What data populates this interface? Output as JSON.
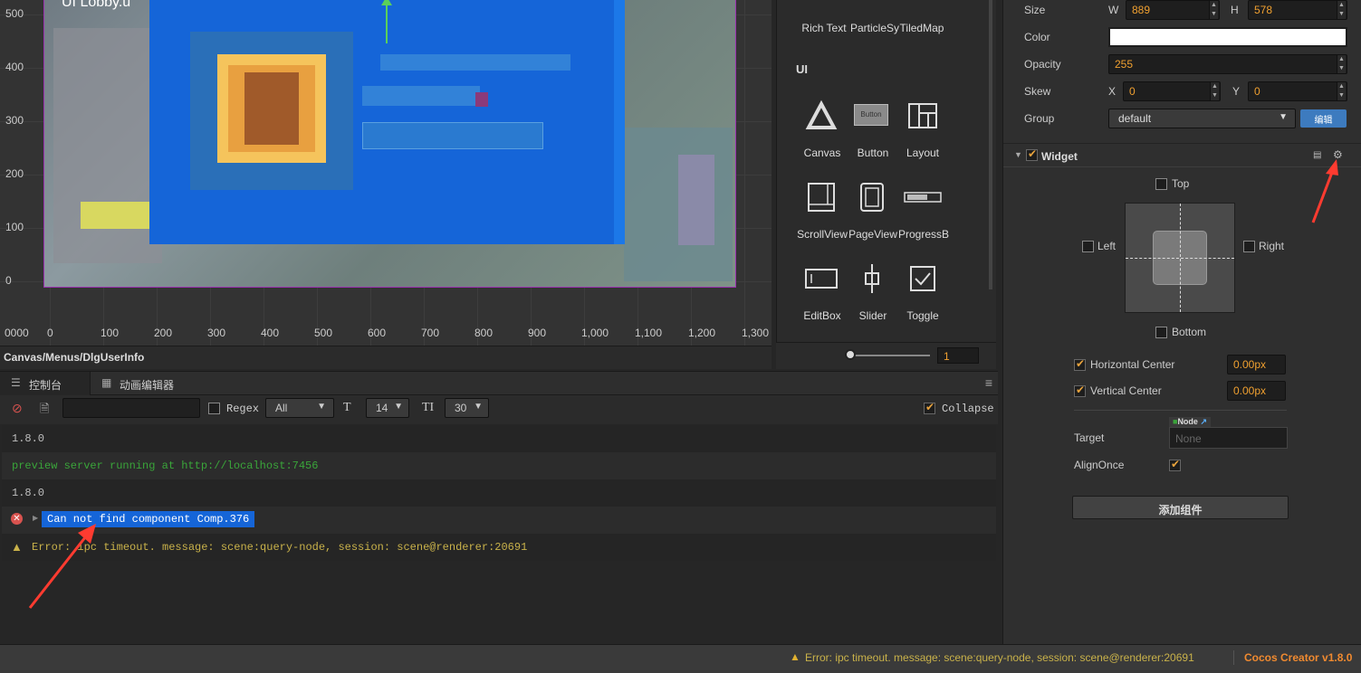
{
  "scene": {
    "y_labels": [
      "500",
      "400",
      "300",
      "200",
      "100",
      "0"
    ],
    "x_labels": [
      "0000",
      "0",
      "100",
      "200",
      "300",
      "400",
      "500",
      "600",
      "700",
      "800",
      "900",
      "1,000",
      "1,100",
      "1,200",
      "1,300"
    ],
    "overlay_text": "UI Lobby.u"
  },
  "path_bar": {
    "path": "Canvas/Menus/DlgUserInfo"
  },
  "widget_library": {
    "top_row": [
      "Rich Text",
      "ParticleSy",
      "TiledMap"
    ],
    "section_ui": "UI",
    "items_row1": [
      {
        "label": "Canvas",
        "icon": "canvas-triangle-icon"
      },
      {
        "label": "Button",
        "icon": "button-icon",
        "icon_text": "Button"
      },
      {
        "label": "Layout",
        "icon": "layout-icon"
      }
    ],
    "items_row2": [
      {
        "label": "ScrollView",
        "icon": "scrollview-icon"
      },
      {
        "label": "PageView",
        "icon": "pageview-icon"
      },
      {
        "label": "ProgressB",
        "icon": "progressbar-icon"
      }
    ],
    "items_row3": [
      {
        "label": "EditBox",
        "icon": "editbox-icon"
      },
      {
        "label": "Slider",
        "icon": "slider-icon"
      },
      {
        "label": "Toggle",
        "icon": "toggle-icon"
      }
    ],
    "zoom_value": "1"
  },
  "console": {
    "tabs": [
      {
        "label": "控制台",
        "icon": "console-icon"
      },
      {
        "label": "动画编辑器",
        "icon": "animation-icon"
      }
    ],
    "toolbar": {
      "regex_label": "Regex",
      "filter_value": "All",
      "font_size": "14",
      "line_height": "30",
      "collapse_label": "Collapse"
    },
    "lines": [
      {
        "text": "1.8.0",
        "color": "#bfbfbf",
        "kind": "log"
      },
      {
        "text": "preview server running at http://localhost:7456",
        "color": "#3aa53a",
        "kind": "info"
      },
      {
        "text": "1.8.0",
        "color": "#bfbfbf",
        "kind": "log"
      },
      {
        "text": "Can not find component Comp.376",
        "color": "#ffffff",
        "kind": "error"
      },
      {
        "text": "Error: ipc timeout. message: scene:query-node, session: scene@renderer:20691",
        "color": "#c9b24a",
        "kind": "warning"
      }
    ]
  },
  "inspector": {
    "size_label": "Size",
    "w_label": "W",
    "w_value": "889",
    "h_label": "H",
    "h_value": "578",
    "color_label": "Color",
    "color_value": "#ffffff",
    "opacity_label": "Opacity",
    "opacity_value": "255",
    "skew_label": "Skew",
    "skew_x_label": "X",
    "skew_x_value": "0",
    "skew_y_label": "Y",
    "skew_y_value": "0",
    "group_label": "Group",
    "group_value": "default",
    "group_edit": "编辑",
    "widget": {
      "title": "Widget",
      "top": "Top",
      "left": "Left",
      "right": "Right",
      "bottom": "Bottom",
      "hcenter_label": "Horizontal Center",
      "hcenter_value": "0.00px",
      "vcenter_label": "Vertical Center",
      "vcenter_value": "0.00px",
      "target_label": "Target",
      "target_type": "Node",
      "target_value": "None",
      "alignonce_label": "AlignOnce"
    },
    "add_component": "添加组件"
  },
  "status_bar": {
    "message": "Error: ipc timeout. message: scene:query-node, session: scene@renderer:20691",
    "app_version": "Cocos Creator v1.8.0"
  },
  "colors": {
    "accent": "#e8a33d",
    "selection": "#1565d8",
    "error": "#d9534f",
    "warning": "#c9b24a",
    "annotation_arrow": "#ff3b30"
  }
}
